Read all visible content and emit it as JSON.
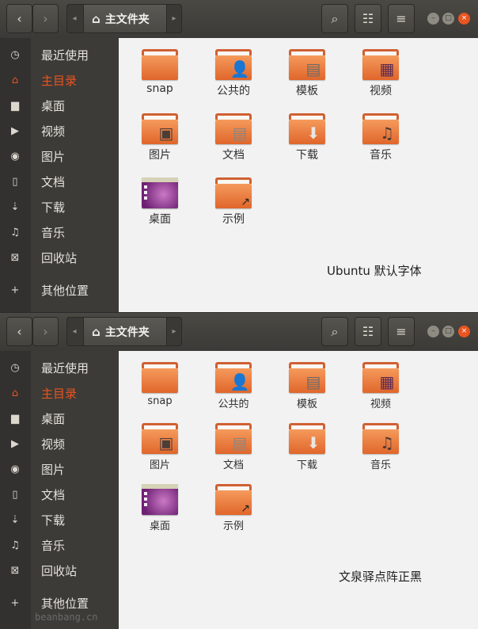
{
  "windows": [
    {
      "path_label": "主文件夹",
      "sidebar": [
        {
          "label": "最近使用",
          "icon": "◷",
          "active": false
        },
        {
          "label": "主目录",
          "icon": "⌂",
          "active": true
        },
        {
          "label": "桌面",
          "icon": "▆",
          "active": false
        },
        {
          "label": "视频",
          "icon": "▶",
          "active": false
        },
        {
          "label": "图片",
          "icon": "◉",
          "active": false
        },
        {
          "label": "文档",
          "icon": "▯",
          "active": false
        },
        {
          "label": "下载",
          "icon": "⇣",
          "active": false
        },
        {
          "label": "音乐",
          "icon": "♫",
          "active": false
        },
        {
          "label": "回收站",
          "icon": "⊠",
          "active": false
        },
        {
          "label": "其他位置",
          "icon": "+",
          "active": false
        }
      ],
      "files": [
        {
          "name": "snap",
          "emblem": ""
        },
        {
          "name": "公共的",
          "emblem": "👤"
        },
        {
          "name": "模板",
          "emblem": "▤"
        },
        {
          "name": "视频",
          "emblem": "▦"
        },
        {
          "name": "图片",
          "emblem": "▣"
        },
        {
          "name": "文档",
          "emblem": "▤"
        },
        {
          "name": "下载",
          "emblem": "⬇"
        },
        {
          "name": "音乐",
          "emblem": "♫"
        },
        {
          "name": "桌面",
          "emblem": ""
        },
        {
          "name": "示例",
          "emblem": "↗"
        }
      ],
      "caption": "Ubuntu 默认字体"
    },
    {
      "path_label": "主文件夹",
      "sidebar": [
        {
          "label": "最近使用",
          "icon": "◷",
          "active": false
        },
        {
          "label": "主目录",
          "icon": "⌂",
          "active": true
        },
        {
          "label": "桌面",
          "icon": "▆",
          "active": false
        },
        {
          "label": "视频",
          "icon": "▶",
          "active": false
        },
        {
          "label": "图片",
          "icon": "◉",
          "active": false
        },
        {
          "label": "文档",
          "icon": "▯",
          "active": false
        },
        {
          "label": "下载",
          "icon": "⇣",
          "active": false
        },
        {
          "label": "音乐",
          "icon": "♫",
          "active": false
        },
        {
          "label": "回收站",
          "icon": "⊠",
          "active": false
        },
        {
          "label": "其他位置",
          "icon": "+",
          "active": false
        }
      ],
      "files": [
        {
          "name": "snap",
          "emblem": ""
        },
        {
          "name": "公共的",
          "emblem": "👤"
        },
        {
          "name": "模板",
          "emblem": "▤"
        },
        {
          "name": "视频",
          "emblem": "▦"
        },
        {
          "name": "图片",
          "emblem": "▣"
        },
        {
          "name": "文档",
          "emblem": "▤"
        },
        {
          "name": "下载",
          "emblem": "⬇"
        },
        {
          "name": "音乐",
          "emblem": "♫"
        },
        {
          "name": "桌面",
          "emblem": ""
        },
        {
          "name": "示例",
          "emblem": "↗"
        }
      ],
      "caption": "文泉驿点阵正黑"
    }
  ],
  "toolbar": {
    "back_icon": "‹",
    "forward_icon": "›",
    "path_left_icon": "◂",
    "path_right_icon": "▸",
    "home_icon": "⌂",
    "search_icon": "⌕",
    "view_icon": "☷",
    "menu_icon": "≡",
    "minimize_icon": "–",
    "maximize_icon": "□",
    "close_icon": "×"
  },
  "colors": {
    "accent": "#e95420",
    "header": "#3f3e3a",
    "sidebar": "#3c3b37",
    "content": "#f2f2f2"
  },
  "watermark": "beanbang.cn"
}
